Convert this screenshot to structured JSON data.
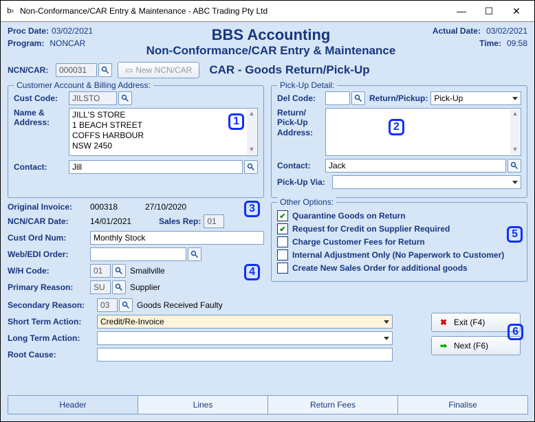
{
  "window": {
    "title": "Non-Conformance/CAR Entry & Maintenance - ABC Trading Pty Ltd"
  },
  "header": {
    "proc_date_lbl": "Proc Date:",
    "proc_date": "03/02/2021",
    "program_lbl": "Program:",
    "program": "NONCAR",
    "big_title": "BBS Accounting",
    "sub_title": "Non-Conformance/CAR Entry & Maintenance",
    "actual_date_lbl": "Actual Date:",
    "actual_date": "03/02/2021",
    "time_lbl": "Time:",
    "time": "09:58"
  },
  "ncnbar": {
    "lbl": "NCN/CAR:",
    "value": "000031",
    "newbtn": "New NCN/CAR",
    "mode": "CAR - Goods Return/Pick-Up"
  },
  "cust": {
    "legend": "Customer Account & Billing Address:",
    "code_lbl": "Cust Code:",
    "code": "JILSTO",
    "name_lbl": "Name & Address:",
    "addr1": "JILL'S STORE",
    "addr2": "1 BEACH STREET",
    "addr3": "COFFS HARBOUR",
    "addr4": "NSW 2450",
    "contact_lbl": "Contact:",
    "contact": "Jill"
  },
  "pickup": {
    "legend": "Pick-Up Detail:",
    "del_lbl": "Del Code:",
    "del": "",
    "ret_lbl": "Return/Pickup:",
    "ret": "Pick-Up",
    "addr_lbl": "Return/ Pick-Up Address:",
    "contact_lbl": "Contact:",
    "contact": "Jack",
    "via_lbl": "Pick-Up Via:",
    "via": ""
  },
  "mid": {
    "orig_inv_lbl": "Original Invoice:",
    "orig_inv_no": "000318",
    "orig_inv_date": "27/10/2020",
    "ncn_date_lbl": "NCN/CAR Date:",
    "ncn_date": "14/01/2021",
    "sales_rep_lbl": "Sales Rep:",
    "sales_rep": "01",
    "cust_ord_lbl": "Cust Ord Num:",
    "cust_ord": "Monthly Stock",
    "web_lbl": "Web/EDI Order:",
    "web": "",
    "wh_lbl": "W/H Code:",
    "wh": "01",
    "wh_name": "Smallville",
    "preason_lbl": "Primary Reason:",
    "preason": "SU",
    "preason_name": "Supplier",
    "sreason_lbl": "Secondary Reason:",
    "sreason": "03",
    "sreason_name": "Goods Received Faulty",
    "sta_lbl": "Short Term Action:",
    "sta": "Credit/Re-Invoice",
    "lta_lbl": "Long Term Action:",
    "lta": "",
    "root_lbl": "Root Cause:",
    "root": ""
  },
  "opts": {
    "legend": "Other Options:",
    "o1": "Quarantine Goods on Return",
    "o2": "Request for Credit on Supplier Required",
    "o3": "Charge Customer Fees for Return",
    "o4": "Internal Adjustment Only (No Paperwork to Customer)",
    "o5": "Create New Sales Order for additional goods"
  },
  "actions": {
    "exit": "Exit (F4)",
    "next": "Next (F6)"
  },
  "tabs": {
    "t1": "Header",
    "t2": "Lines",
    "t3": "Return Fees",
    "t4": "Finalise"
  },
  "callouts": {
    "c1": "1",
    "c2": "2",
    "c3": "3",
    "c4": "4",
    "c5": "5",
    "c6": "6"
  }
}
